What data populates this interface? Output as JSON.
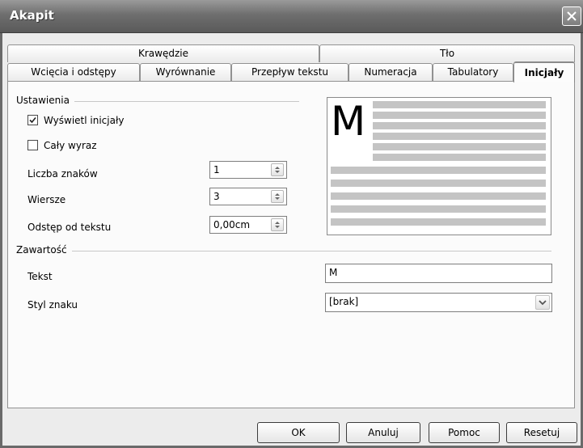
{
  "window": {
    "title": "Akapit",
    "close_icon": "close-icon"
  },
  "tabs_row1": [
    {
      "label": "Krawędzie"
    },
    {
      "label": "Tło"
    }
  ],
  "tabs_row2": [
    {
      "label": "Wcięcia i odstępy"
    },
    {
      "label": "Wyrównanie"
    },
    {
      "label": "Przepływ tekstu"
    },
    {
      "label": "Numeracja"
    },
    {
      "label": "Tabulatory"
    },
    {
      "label": "Inicjały",
      "active": true
    }
  ],
  "settings": {
    "group_label": "Ustawienia",
    "show_dropcaps": {
      "label": "Wyświetl inicjały",
      "checked": true
    },
    "whole_word": {
      "label": "Cały wyraz",
      "checked": false
    },
    "num_chars": {
      "label": "Liczba znaków",
      "value": "1"
    },
    "lines": {
      "label": "Wiersze",
      "value": "3"
    },
    "spacing": {
      "label": "Odstęp od tekstu",
      "value": "0,00cm"
    }
  },
  "preview": {
    "letter": "M"
  },
  "contents": {
    "group_label": "Zawartość",
    "text": {
      "label": "Tekst",
      "value": "M"
    },
    "char_style": {
      "label": "Styl znaku",
      "value": "[brak]"
    }
  },
  "buttons": {
    "ok": "OK",
    "cancel": "Anuluj",
    "help": "Pomoc",
    "reset": "Resetuj"
  }
}
